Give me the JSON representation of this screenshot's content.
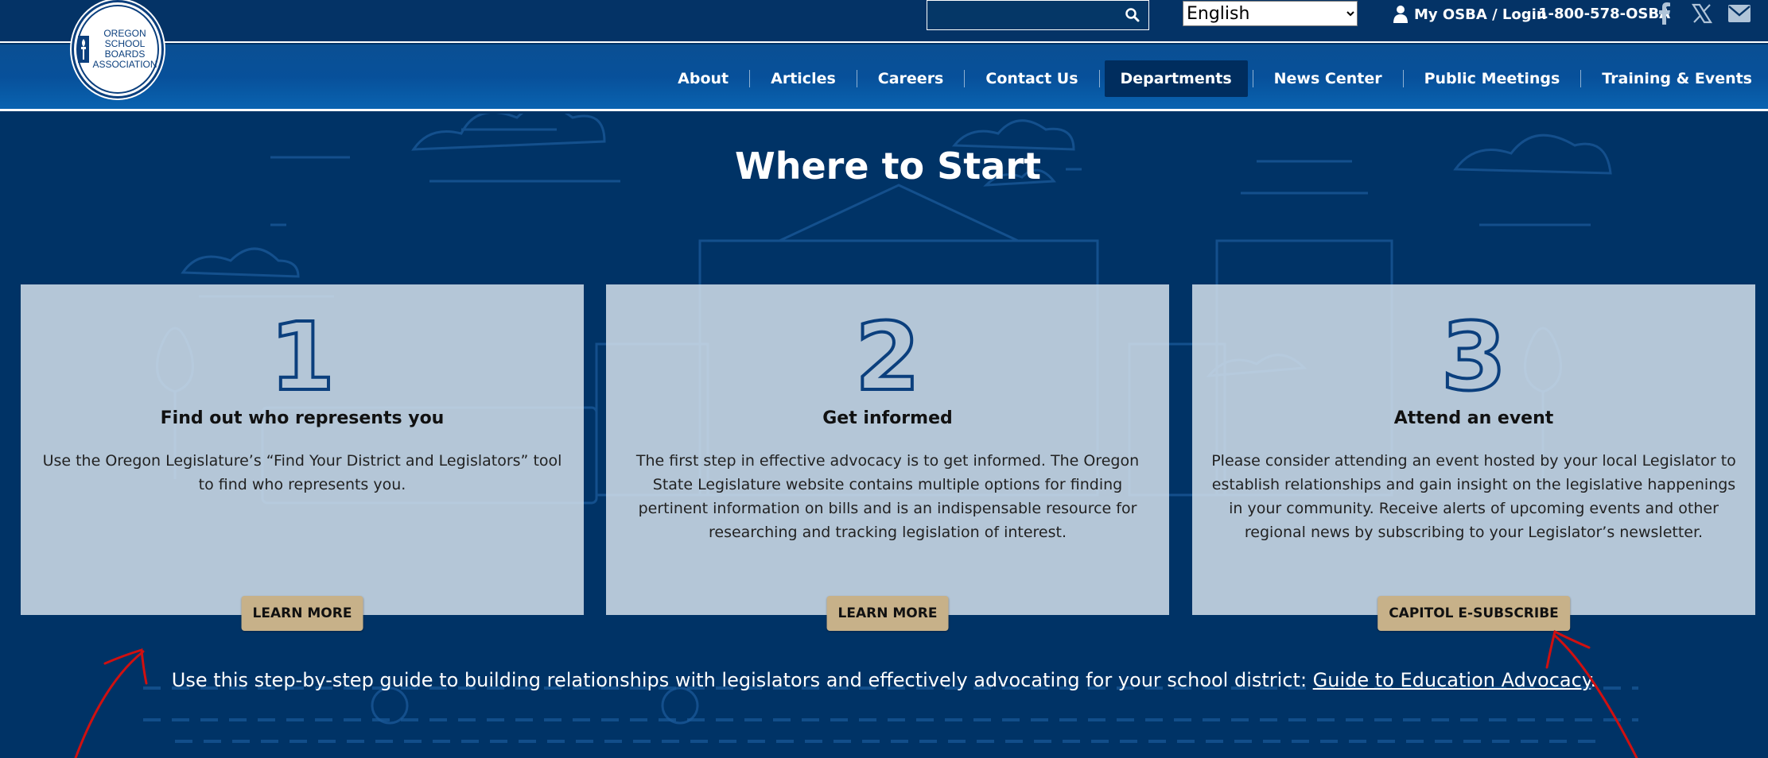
{
  "search": {
    "value": "",
    "placeholder": ""
  },
  "language": {
    "selected": "English"
  },
  "utility": {
    "login_label": "My OSBA / Login",
    "phone": "1-800-578-OSBA",
    "social": [
      "facebook-icon",
      "x-icon",
      "mail-icon"
    ]
  },
  "logo": {
    "lines": [
      "OREGON",
      "SCHOOL",
      "BOARDS",
      "ASSOCIATION"
    ]
  },
  "nav": {
    "items": [
      {
        "label": "About",
        "active": false
      },
      {
        "label": "Articles",
        "active": false
      },
      {
        "label": "Careers",
        "active": false
      },
      {
        "label": "Contact Us",
        "active": false
      },
      {
        "label": "Departments",
        "active": true
      },
      {
        "label": "News Center",
        "active": false
      },
      {
        "label": "Public Meetings",
        "active": false
      },
      {
        "label": "Training & Events",
        "active": false
      }
    ]
  },
  "main": {
    "heading": "Where to Start",
    "cards": [
      {
        "number": "1",
        "title": "Find out who represents you",
        "body": "Use the Oregon Legislature’s “Find Your District and Legislators” tool to find who represents you.",
        "button": "LEARN MORE"
      },
      {
        "number": "2",
        "title": "Get informed",
        "body": "The first step in effective advocacy is to get informed. The Oregon State Legislature website contains multiple options for finding pertinent information on bills and is an indispensable resource for researching and tracking legislation of interest.",
        "button": "LEARN MORE"
      },
      {
        "number": "3",
        "title": "Attend an event",
        "body": "Please consider attending an event hosted by your local Legislator to establish relationships and gain insight on the legislative happenings in your community. Receive alerts of upcoming events and other regional news by subscribing to your Legislator’s newsletter.",
        "button": "CAPITOL E-SUBSCRIBE"
      }
    ],
    "guide_text": "Use this step-by-step guide to building relationships with legislators and effectively advocating for your school district: ",
    "guide_link": "Guide to Education Advocacy",
    "guide_end": "."
  },
  "colors": {
    "page_bg": "#003366",
    "nav_bg": "#07509a",
    "active_nav": "#002d5e",
    "card_bg": "#d2deea",
    "button_bg": "#c7b189",
    "annotation": "#d01010"
  }
}
